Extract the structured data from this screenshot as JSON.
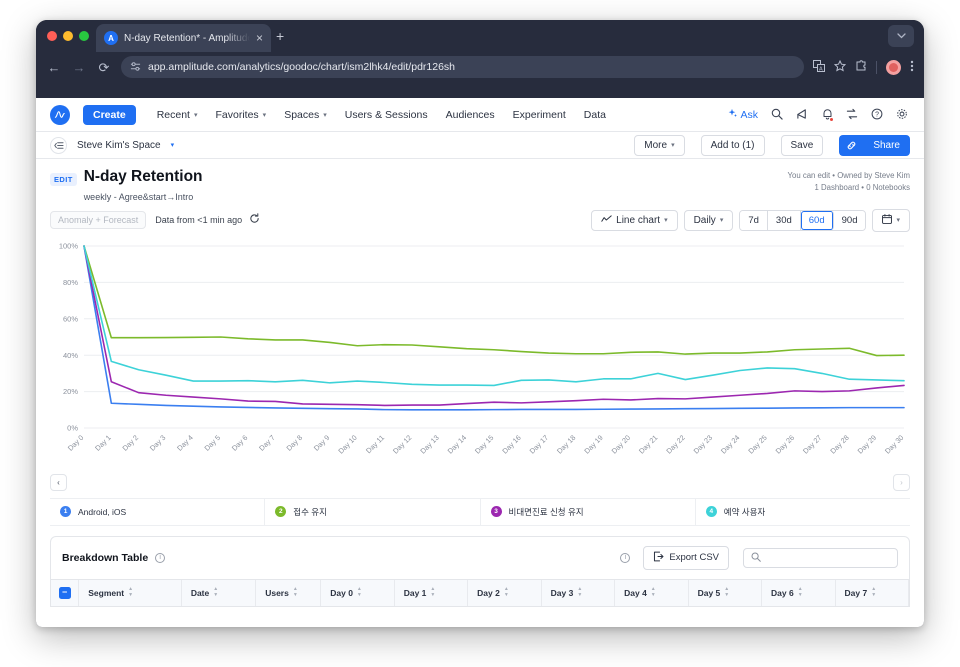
{
  "browser": {
    "tab_title": "N-day Retention* - Amplitude",
    "tab_favicon": "A",
    "new_tab_label": "+",
    "close_label": "×",
    "back_label": "←",
    "forward_label": "→",
    "reload_label": "⟳",
    "url": "app.amplitude.com/analytics/goodoc/chart/ism2lhk4/edit/pdr126sh",
    "site_settings_icon": "tune-icon",
    "translate_icon": "translate-icon",
    "bookmark_icon": "star-icon",
    "extensions_icon": "puzzle-icon",
    "menu_icon": "kebab-menu-icon",
    "window_minimize_icon": "chevron-down-icon"
  },
  "appnav": {
    "logo": "A",
    "create_label": "Create",
    "items": [
      {
        "label": "Recent",
        "caret": "▾"
      },
      {
        "label": "Favorites",
        "caret": "▾"
      },
      {
        "label": "Spaces",
        "caret": "▾"
      },
      {
        "label": "Users & Sessions",
        "caret": ""
      },
      {
        "label": "Audiences",
        "caret": ""
      },
      {
        "label": "Experiment",
        "caret": ""
      },
      {
        "label": "Data",
        "caret": ""
      }
    ],
    "ask_label": "Ask",
    "ask_icon": "sparkle-icon",
    "search_icon": "search-icon",
    "activity_icon": "megaphone-icon",
    "notifications_icon": "bell-icon",
    "compare_icon": "toggles-icon",
    "help_icon": "question-circle-icon",
    "settings_icon": "gear-icon"
  },
  "spacebar": {
    "panel_toggle_icon": "panel-collapse-icon",
    "space_name": "Steve Kim's Space",
    "space_caret": "▾",
    "more_label": "More",
    "more_caret": "▾",
    "add_to_label": "Add to (1)",
    "save_label": "Save",
    "share_label": "Share",
    "link_icon": "link-icon"
  },
  "header": {
    "edit_badge": "EDIT",
    "title": "N-day Retention",
    "subtitle": "weekly - Agree&start→Intro",
    "meta_line_1": "You can edit • Owned by Steve Kim",
    "meta_line_2": "1 Dashboard • 0 Notebooks"
  },
  "controls": {
    "anomaly_label": "Anomaly + Forecast",
    "data_from": "Data from <1 min ago",
    "refresh_icon": "refresh-icon",
    "chart_type_label": "Line chart",
    "chart_type_icon": "line-chart-icon",
    "chart_type_caret": "▾",
    "interval_label": "Daily",
    "interval_caret": "▾",
    "ranges": [
      {
        "label": "7d",
        "active": false
      },
      {
        "label": "30d",
        "active": false
      },
      {
        "label": "60d",
        "active": true
      },
      {
        "label": "90d",
        "active": false
      }
    ],
    "calendar_icon": "calendar-icon",
    "calendar_caret": "▾"
  },
  "pager": {
    "prev_label": "‹",
    "next_label": "›"
  },
  "legend": [
    {
      "num": "1",
      "label": "Android, iOS",
      "color": "#3b7ff0"
    },
    {
      "num": "2",
      "label": "접수 유지",
      "color": "#7cba2b"
    },
    {
      "num": "3",
      "label": "비대면진료 신청 유지",
      "color": "#9c27b0"
    },
    {
      "num": "4",
      "label": "예약 사용자",
      "color": "#3dd2d8"
    }
  ],
  "breakdown": {
    "title": "Breakdown Table",
    "info_icon": "info-icon",
    "header_info_icon": "info-icon",
    "export_label": "Export CSV",
    "export_icon": "export-icon",
    "search_icon": "search-icon",
    "search_placeholder": "",
    "search_value": "",
    "collapse_label": "−",
    "columns": [
      "Segment",
      "Date",
      "Users",
      "Day 0",
      "Day 1",
      "Day 2",
      "Day 3",
      "Day 4",
      "Day 5",
      "Day 6",
      "Day 7"
    ]
  },
  "chart_data": {
    "type": "line",
    "title": "N-day Retention",
    "xlabel": "",
    "ylabel": "",
    "ylim": [
      0,
      100
    ],
    "yticks": [
      0,
      20,
      40,
      60,
      80,
      100
    ],
    "ytick_labels": [
      "0%",
      "20%",
      "40%",
      "60%",
      "80%",
      "100%"
    ],
    "grid": true,
    "legend_position": "bottom",
    "categories": [
      "Day 0",
      "Day 1",
      "Day 2",
      "Day 3",
      "Day 4",
      "Day 5",
      "Day 6",
      "Day 7",
      "Day 8",
      "Day 9",
      "Day 10",
      "Day 11",
      "Day 12",
      "Day 13",
      "Day 14",
      "Day 15",
      "Day 16",
      "Day 17",
      "Day 18",
      "Day 19",
      "Day 20",
      "Day 21",
      "Day 22",
      "Day 23",
      "Day 24",
      "Day 25",
      "Day 26",
      "Day 27",
      "Day 28",
      "Day 29",
      "Day 30"
    ],
    "series": [
      {
        "name": "Android, iOS",
        "color": "#3b7ff0",
        "values": [
          100,
          13.6,
          13.0,
          12.4,
          12.0,
          11.6,
          11.3,
          11.0,
          10.8,
          10.6,
          10.5,
          10.1,
          10.0,
          10.0,
          10.0,
          10.1,
          10.2,
          10.2,
          10.2,
          10.3,
          10.4,
          10.5,
          10.6,
          10.7,
          10.8,
          10.9,
          11.0,
          11.1,
          11.2,
          11.2,
          11.2
        ]
      },
      {
        "name": "접수 유지",
        "color": "#7cba2b",
        "values": [
          100,
          49.6,
          49.6,
          49.7,
          49.8,
          50.0,
          49.0,
          48.4,
          48.4,
          47.0,
          45.2,
          45.8,
          45.6,
          44.6,
          43.6,
          43.0,
          42.0,
          41.2,
          40.8,
          40.8,
          41.6,
          41.8,
          40.6,
          41.2,
          41.2,
          41.8,
          43.0,
          43.4,
          43.8,
          39.8,
          40.0
        ]
      },
      {
        "name": "비대면진료 신청 유지",
        "color": "#9c27b0",
        "values": [
          100,
          25.4,
          19.4,
          18.0,
          17.0,
          16.0,
          14.8,
          14.6,
          13.2,
          13.0,
          12.8,
          12.4,
          12.6,
          12.6,
          13.4,
          14.2,
          13.8,
          14.4,
          15.0,
          15.8,
          15.4,
          16.2,
          16.0,
          17.0,
          18.0,
          19.0,
          20.4,
          20.0,
          20.4,
          22.0,
          23.4
        ]
      },
      {
        "name": "예약 사용자",
        "color": "#3dd2d8",
        "values": [
          100,
          36.6,
          32.0,
          29.0,
          25.8,
          25.8,
          26.0,
          25.4,
          26.2,
          24.8,
          25.8,
          25.0,
          24.0,
          23.6,
          23.6,
          23.4,
          26.2,
          26.4,
          25.4,
          27.0,
          27.0,
          30.0,
          26.6,
          29.0,
          31.6,
          33.0,
          32.6,
          30.0,
          26.8,
          26.4,
          26.0
        ]
      }
    ]
  }
}
